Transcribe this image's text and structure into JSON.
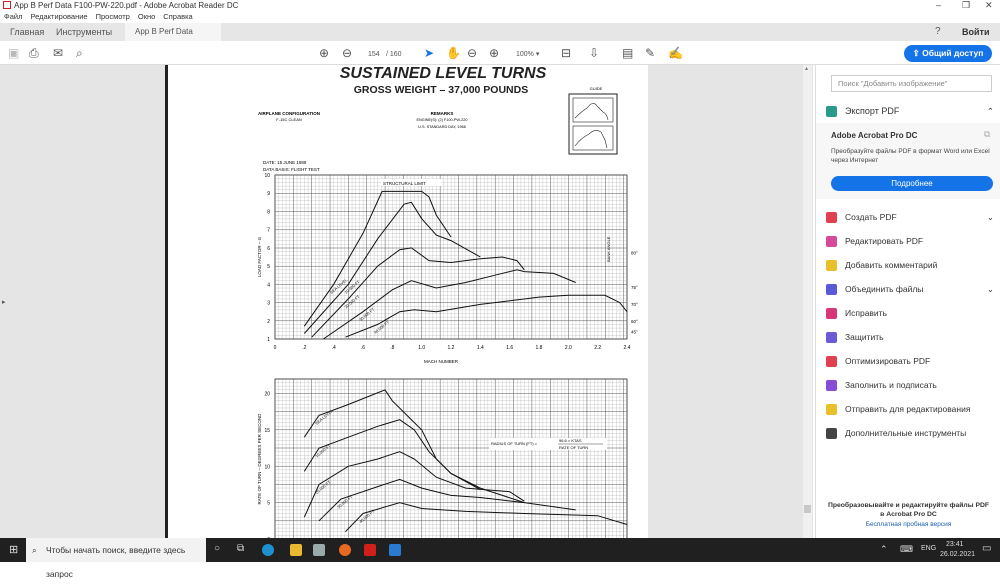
{
  "window": {
    "title": "App B Perf Data F100-PW-220.pdf - Adobe Acrobat Reader DC"
  },
  "menu": [
    "Файл",
    "Редактирование",
    "Просмотр",
    "Окно",
    "Справка"
  ],
  "tabs": {
    "home": "Главная",
    "tools": "Инструменты",
    "doc": "App B Perf Data F1...",
    "close": "×"
  },
  "header": {
    "help": "?",
    "signin": "Войти"
  },
  "toolbar": {
    "page_current": "154",
    "page_total": "/ 160",
    "zoom": "100%",
    "share": "Общий доступ"
  },
  "document": {
    "title": "SUSTAINED LEVEL TURNS",
    "subtitle": "GROSS WEIGHT – 37,000 POUNDS",
    "config_label": "AIRPLANE CONFIGURATION",
    "config_value": "F-15C CLEAN",
    "remarks_label": "REMARKS",
    "remarks_1": "ENGINE(S): (2) F100-PW-220",
    "remarks_2": "U.S. STANDARD DAY, 1966",
    "guide": "GUIDE",
    "date": "DATE:  15 JUNE 1989",
    "data_basis": "DATA BASIS:  FLIGHT TEST"
  },
  "chart_data": [
    {
      "type": "line",
      "title": "Load factor vs Mach",
      "xlabel": "MACH NUMBER",
      "ylabel": "LOAD FACTOR – G",
      "xlim": [
        0,
        2.4
      ],
      "ylim": [
        1,
        10
      ],
      "xticks": [
        "0",
        ".2",
        ".4",
        ".6",
        ".8",
        "1.0",
        "1.2",
        "1.4",
        "1.6",
        "1.8",
        "2.0",
        "2.2",
        "2.4"
      ],
      "yticks": [
        "1",
        "2",
        "3",
        "4",
        "5",
        "6",
        "7",
        "8",
        "9",
        "10"
      ],
      "annotations": {
        "structural": "STRUCTURAL LIMIT",
        "bank": "BANK ANGLE"
      },
      "bank_angles": [
        {
          "label": "80°",
          "g": 5.76
        },
        {
          "label": "75°",
          "g": 3.86
        },
        {
          "label": "70°",
          "g": 2.92
        },
        {
          "label": "60°",
          "g": 2.0
        },
        {
          "label": "45°",
          "g": 1.41
        }
      ],
      "series": [
        {
          "name": "SEA LEVEL",
          "points": [
            [
              0.2,
              1.7
            ],
            [
              0.4,
              4
            ],
            [
              0.6,
              6.8
            ],
            [
              0.73,
              9.1
            ],
            [
              1.0,
              9.1
            ],
            [
              1.05,
              8.8
            ],
            [
              1.1,
              7.8
            ],
            [
              1.2,
              6.6
            ]
          ]
        },
        {
          "name": "10,000 FT",
          "points": [
            [
              0.2,
              1.3
            ],
            [
              0.5,
              4
            ],
            [
              0.7,
              6.5
            ],
            [
              0.88,
              8.4
            ],
            [
              0.93,
              8.5
            ],
            [
              1.0,
              7.6
            ],
            [
              1.1,
              6.7
            ],
            [
              1.2,
              6.4
            ],
            [
              1.4,
              5.5
            ]
          ]
        },
        {
          "name": "20,000 FT",
          "points": [
            [
              0.25,
              1.1
            ],
            [
              0.5,
              3.2
            ],
            [
              0.7,
              5
            ],
            [
              0.85,
              5.9
            ],
            [
              0.93,
              6
            ],
            [
              1.05,
              5.3
            ],
            [
              1.2,
              5.2
            ],
            [
              1.4,
              5.4
            ],
            [
              1.55,
              5.5
            ],
            [
              1.65,
              5.3
            ],
            [
              1.7,
              4.8
            ]
          ]
        },
        {
          "name": "30,000 FT",
          "points": [
            [
              0.33,
              1
            ],
            [
              0.6,
              2.5
            ],
            [
              0.8,
              3.7
            ],
            [
              0.93,
              4.2
            ],
            [
              1.1,
              3.8
            ],
            [
              1.3,
              4.1
            ],
            [
              1.5,
              4.5
            ],
            [
              1.65,
              4.8
            ],
            [
              1.7,
              4.7
            ],
            [
              1.9,
              4.6
            ],
            [
              2.05,
              4.1
            ]
          ]
        },
        {
          "name": "40,000 FT",
          "points": [
            [
              0.48,
              1.1
            ],
            [
              0.7,
              1.8
            ],
            [
              0.85,
              2.5
            ],
            [
              0.95,
              2.6
            ],
            [
              1.1,
              2.5
            ],
            [
              1.4,
              2.9
            ],
            [
              1.8,
              3.3
            ],
            [
              2.0,
              3.4
            ],
            [
              2.25,
              3.4
            ],
            [
              2.35,
              3
            ],
            [
              2.4,
              2.5
            ]
          ]
        }
      ]
    },
    {
      "type": "line",
      "title": "Rate of turn vs Mach",
      "xlabel": "",
      "ylabel": "RATE OF TURN – DEGREES PER SECOND",
      "xlim": [
        0,
        2.4
      ],
      "ylim": [
        0,
        22
      ],
      "yticks": [
        "0",
        "5",
        "10",
        "15",
        "20"
      ],
      "annotations": {
        "formula_left": "RADIUS OF TURN (FT) =",
        "formula_num": "96.6 × KTAS",
        "formula_den": "RATE OF TURN"
      },
      "series": [
        {
          "name": "SEA LEVEL",
          "points": [
            [
              0.2,
              14
            ],
            [
              0.3,
              17
            ],
            [
              0.5,
              18.5
            ],
            [
              0.75,
              20.5
            ],
            [
              0.8,
              19
            ],
            [
              0.9,
              17
            ],
            [
              1.0,
              15
            ],
            [
              1.1,
              11
            ],
            [
              1.2,
              9
            ],
            [
              1.4,
              6.8
            ]
          ]
        },
        {
          "name": "10,000 FT",
          "points": [
            [
              0.2,
              9.3
            ],
            [
              0.3,
              12.5
            ],
            [
              0.5,
              14
            ],
            [
              0.7,
              15.5
            ],
            [
              0.85,
              16.4
            ],
            [
              0.95,
              15
            ],
            [
              1.05,
              12
            ],
            [
              1.2,
              9
            ],
            [
              1.4,
              7
            ],
            [
              1.7,
              5
            ]
          ]
        },
        {
          "name": "20,000 FT",
          "points": [
            [
              0.2,
              3
            ],
            [
              0.3,
              7.5
            ],
            [
              0.5,
              10
            ],
            [
              0.7,
              11
            ],
            [
              0.85,
              12
            ],
            [
              0.95,
              11
            ],
            [
              1.1,
              8.5
            ],
            [
              1.3,
              7
            ],
            [
              1.6,
              6.5
            ],
            [
              1.7,
              5.2
            ]
          ]
        },
        {
          "name": "30,000 FT",
          "points": [
            [
              0.3,
              2.5
            ],
            [
              0.45,
              5.5
            ],
            [
              0.7,
              7.2
            ],
            [
              0.85,
              8.2
            ],
            [
              1.0,
              7
            ],
            [
              1.2,
              6
            ],
            [
              1.4,
              5.7
            ],
            [
              1.7,
              5
            ],
            [
              2.05,
              4
            ]
          ]
        },
        {
          "name": "40,000 FT",
          "points": [
            [
              0.48,
              1
            ],
            [
              0.6,
              3.5
            ],
            [
              0.85,
              5
            ],
            [
              1.0,
              4.2
            ],
            [
              1.3,
              3.8
            ],
            [
              1.7,
              3.5
            ],
            [
              2.2,
              3.2
            ],
            [
              2.4,
              2
            ]
          ]
        }
      ]
    }
  ],
  "panel": {
    "search_placeholder": "Поиск \"Добавить изображение\"",
    "export": "Экспорт PDF",
    "promo_title": "Adobe Acrobat Pro DC",
    "promo_text": "Преобразуйте файлы PDF в формат Word или Excel через Интернет",
    "promo_button": "Подробнее",
    "items": [
      {
        "label": "Создать PDF",
        "color": "#e0404f",
        "chev": "⌄"
      },
      {
        "label": "Редактировать PDF",
        "color": "#d74a9a",
        "chev": ""
      },
      {
        "label": "Добавить комментарий",
        "color": "#e8c02a",
        "chev": ""
      },
      {
        "label": "Объединить файлы",
        "color": "#5a5ad8",
        "chev": "⌄"
      },
      {
        "label": "Исправить",
        "color": "#d8367a",
        "chev": ""
      },
      {
        "label": "Защитить",
        "color": "#6a5ad8",
        "chev": ""
      },
      {
        "label": "Оптимизировать PDF",
        "color": "#e0404f",
        "chev": ""
      },
      {
        "label": "Заполнить и подписать",
        "color": "#8a4ad8",
        "chev": ""
      },
      {
        "label": "Отправить для редактирования",
        "color": "#e8c02a",
        "chev": ""
      },
      {
        "label": "Дополнительные инструменты",
        "color": "#444444",
        "chev": ""
      }
    ],
    "footer_text": "Преобразовывайте и редактируйте файлы PDF в Acrobat Pro DC",
    "footer_link": "Бесплатная пробная версия"
  },
  "taskbar": {
    "search_placeholder": "Чтобы начать поиск, введите здесь запрос",
    "lang": "ENG",
    "time": "23:41",
    "date": "26.02.2021"
  }
}
